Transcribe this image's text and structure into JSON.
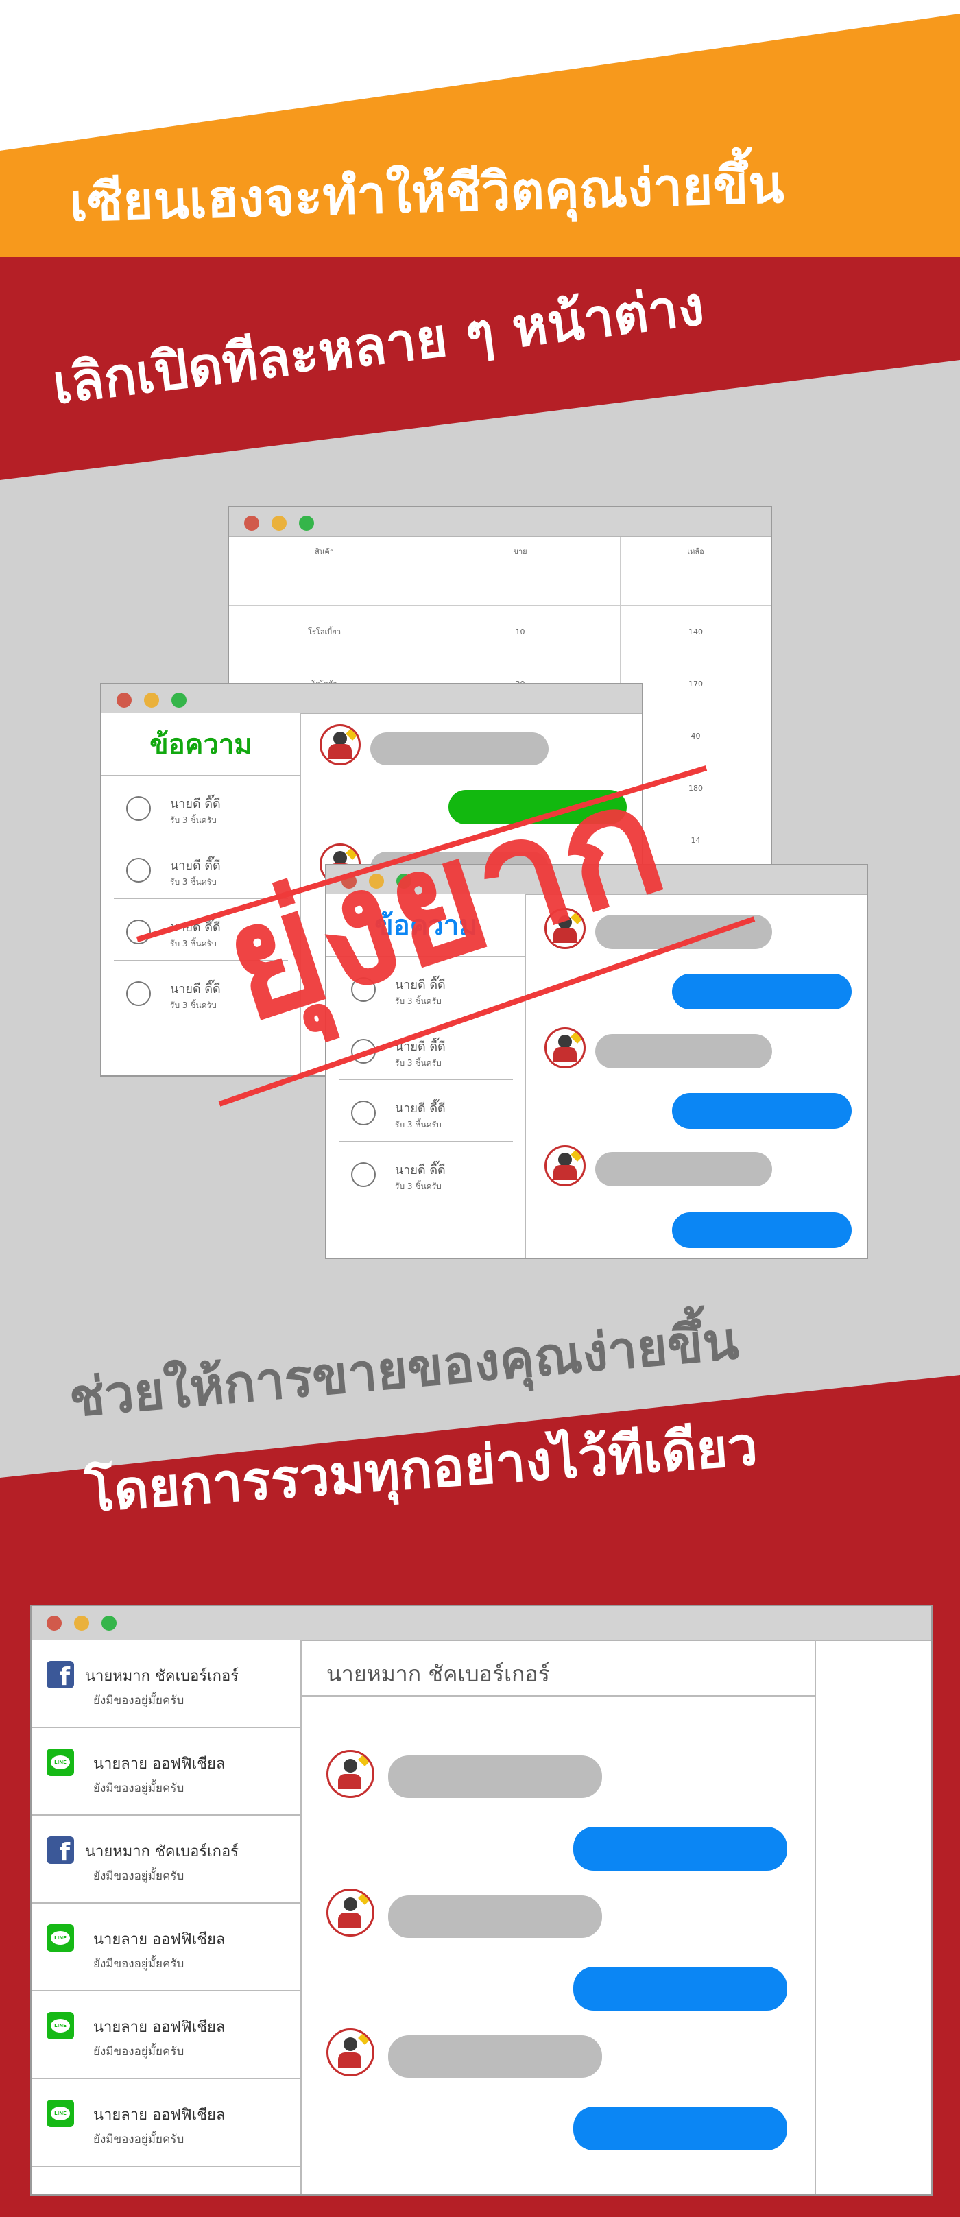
{
  "colors": {
    "orange": "#f7991c",
    "red": "#b51f26",
    "grey_bg": "#d0d0d0",
    "blue_bubble": "#0b86f4",
    "green_bubble": "#12b80f",
    "stamp": "#ef3a3a"
  },
  "headline1": "เซียนเฮงจะทำให้ชีวิตคุณง่ายขึ้น",
  "headline2": "เลิกเปิดทีละหลาย ๆ หน้าต่าง",
  "headline3": "ช่วยให้การขายของคุณง่ายขึ้น",
  "headline4": "โดยการรวมทุกอย่างไว้ทีเดียว",
  "stamp": "ยุ่งยาก",
  "stock_table": {
    "headers": [
      "สินค้า",
      "ขาย",
      "เหลือ"
    ],
    "rows": [
      [
        "โรโลเบี้ยว",
        "10",
        "140"
      ],
      [
        "โรโลก้า",
        "30",
        "170"
      ],
      [
        "",
        "",
        "40"
      ],
      [
        "",
        "",
        "180"
      ],
      [
        "",
        "",
        "14"
      ]
    ]
  },
  "window_green": {
    "title": "ข้อความ",
    "contacts": [
      {
        "name": "นายดี ดี๊ดี",
        "msg": "รับ 3 ชิ้นครับ"
      },
      {
        "name": "นายดี ดี๊ดี",
        "msg": "รับ 3 ชิ้นครับ"
      },
      {
        "name": "นายดี ดี๊ดี",
        "msg": "รับ 3 ชิ้นครับ"
      },
      {
        "name": "นายดี ดี๊ดี",
        "msg": "รับ 3 ชิ้นครับ"
      }
    ]
  },
  "window_blue": {
    "title": "ข้อความ",
    "contacts": [
      {
        "name": "นายดี ดี๊ดี",
        "msg": "รับ 3 ชิ้นครับ"
      },
      {
        "name": "นายดี ดี๊ดี",
        "msg": "รับ 3 ชิ้นครับ"
      },
      {
        "name": "นายดี ดี๊ดี",
        "msg": "รับ 3 ชิ้นครับ"
      },
      {
        "name": "นายดี ดี๊ดี",
        "msg": "รับ 3 ชิ้นครับ"
      }
    ]
  },
  "combined": {
    "chat_header": "นายหมาก ชัคเบอร์เกอร์",
    "items": [
      {
        "icon": "facebook-icon",
        "name": "นายหมาก ชัคเบอร์เกอร์",
        "msg": "ยังมีของอยู่มั้ยครับ"
      },
      {
        "icon": "line-icon",
        "name": "นายลาย ออฟฟิเชียล",
        "msg": "ยังมีของอยู่มั้ยครับ"
      },
      {
        "icon": "facebook-icon",
        "name": "นายหมาก ชัคเบอร์เกอร์",
        "msg": "ยังมีของอยู่มั้ยครับ"
      },
      {
        "icon": "line-icon",
        "name": "นายลาย ออฟฟิเชียล",
        "msg": "ยังมีของอยู่มั้ยครับ"
      },
      {
        "icon": "line-icon",
        "name": "นายลาย ออฟฟิเชียล",
        "msg": "ยังมีของอยู่มั้ยครับ"
      },
      {
        "icon": "line-icon",
        "name": "นายลาย ออฟฟิเชียล",
        "msg": "ยังมีของอยู่มั้ยครับ"
      }
    ],
    "line_logo_text": "LINE",
    "fb_logo_text": "f"
  }
}
